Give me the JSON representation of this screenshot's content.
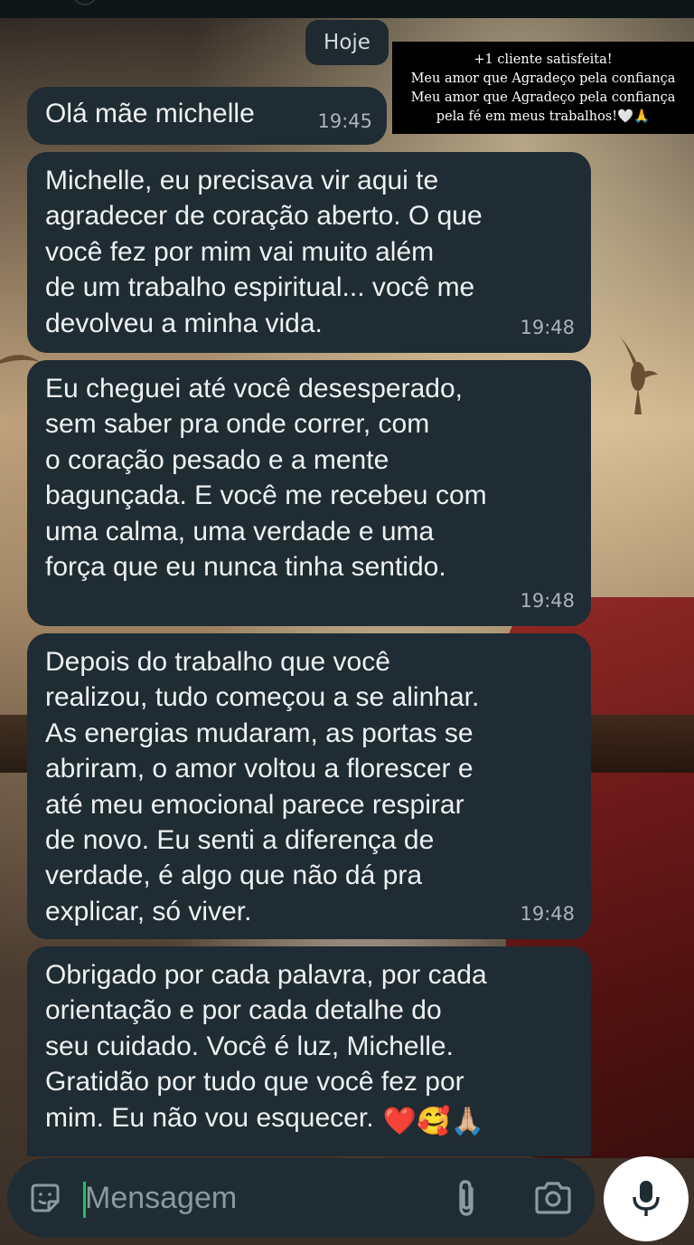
{
  "date_chip": "Hoje",
  "overlay_note": {
    "lines": [
      "+1 cliente satisfeita!",
      "Meu amor que Agradeço pela confiança",
      "Meu amor que Agradeço pela confiança",
      "pela fé em meus trabalhos!🤍🙏"
    ]
  },
  "messages": [
    {
      "lines": [
        "Olá mãe michelle"
      ],
      "time": "19:45"
    },
    {
      "lines": [
        "Michelle, eu precisava vir aqui te",
        "agradecer de coração aberto. O que",
        "você fez por mim vai muito além",
        "de um trabalho espiritual... você me",
        "devolveu a minha vida."
      ],
      "time": "19:48"
    },
    {
      "lines": [
        "Eu cheguei até você desesperado,",
        "sem saber pra onde correr, com",
        "o coração pesado e a mente",
        "bagunçada. E você me recebeu com",
        "uma calma, uma verdade e uma",
        "força que eu nunca tinha sentido."
      ],
      "time": "19:48"
    },
    {
      "lines": [
        "Depois do trabalho que você",
        "realizou, tudo começou a se alinhar.",
        "As energias mudaram, as portas se",
        "abriram, o amor voltou a florescer e",
        "até meu emocional parece respirar",
        "de novo. Eu senti a diferença de",
        "verdade, é algo que não dá pra",
        "explicar, só viver."
      ],
      "time": "19:48"
    },
    {
      "lines": [
        "Obrigado por cada palavra, por cada",
        "orientação e por cada detalhe do",
        "seu cuidado. Você é luz, Michelle.",
        "Gratidão por tudo que você fez por",
        "mim. Eu não vou esquecer."
      ],
      "emojis": "❤️🥰🙏🏼"
    }
  ],
  "composer": {
    "placeholder": "Mensagem"
  },
  "icons": {
    "sticker": "sticker-icon",
    "attach": "paperclip-icon",
    "camera": "camera-icon",
    "mic": "microphone-icon"
  },
  "colors": {
    "bubble": "#1f2c33",
    "caret": "#21c063",
    "timestamp": "#aab4b8"
  }
}
